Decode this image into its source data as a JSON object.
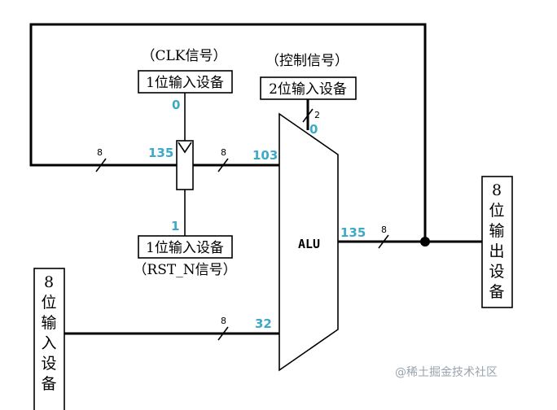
{
  "colors": {
    "value": "#3ca9c8",
    "line": "#000000",
    "watermark": "#9aa3ab"
  },
  "labels": {
    "clk_caption": "（CLK信号）",
    "clk_box": "1位输入设备",
    "ctrl_caption": "（控制信号）",
    "ctrl_box": "2位输入设备",
    "rst_box": "1位输入设备",
    "rst_caption": "（RST_N信号）",
    "alu": "ALU",
    "output_box": [
      "8",
      "位",
      "输",
      "出",
      "设",
      "备"
    ],
    "input_box": [
      "8",
      "位",
      "输",
      "入",
      "设",
      "备"
    ]
  },
  "values": {
    "clk": "0",
    "ctrl": "0",
    "rst": "1",
    "reg_out": "135",
    "alu_a": "103",
    "alu_b": "32",
    "alu_out": "135"
  },
  "bus_widths": {
    "feedback": "8",
    "reg_to_alu": "8",
    "ctrl": "2",
    "input": "8",
    "output": "8"
  },
  "watermark": "@稀土掘金技术社区"
}
